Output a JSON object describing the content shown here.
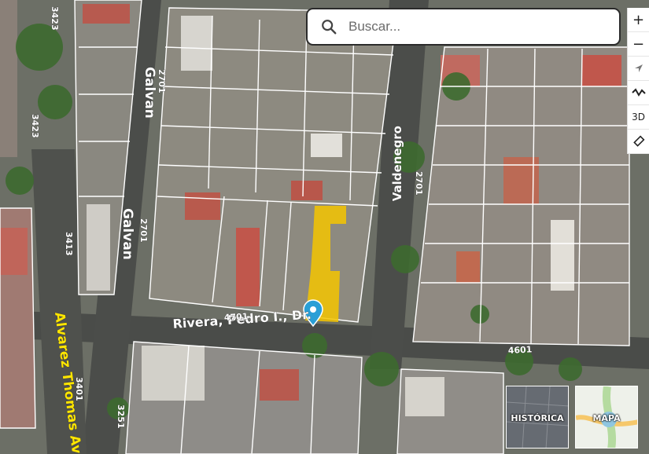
{
  "search": {
    "placeholder": "Buscar..."
  },
  "controls": {
    "zoom_in": "+",
    "zoom_out": "−",
    "view_3d": "3D"
  },
  "streets": {
    "galvan_1": "Galvan",
    "galvan_2": "Galvan",
    "galvan_num_1": "2701",
    "galvan_num_2": "2701",
    "valdenegro": "Valdenegro",
    "valdenegro_num": "2701",
    "rivera": "Rivera, Pedro I., Dr.",
    "rivera_num": "4701",
    "rivera_num_2": "4601",
    "num_3423_a": "3423",
    "num_3423_b": "3423",
    "num_3413": "3413",
    "num_3401": "3401",
    "num_3251": "3251",
    "alvarez": "Alvarez Thomas Av."
  },
  "layers": {
    "historica": "HISTÓRICA",
    "mapa": "MAPA"
  },
  "colors": {
    "highlight_parcel": "#f5c400",
    "marker": "#2a9fd6",
    "avenue_label": "#ffe600"
  }
}
